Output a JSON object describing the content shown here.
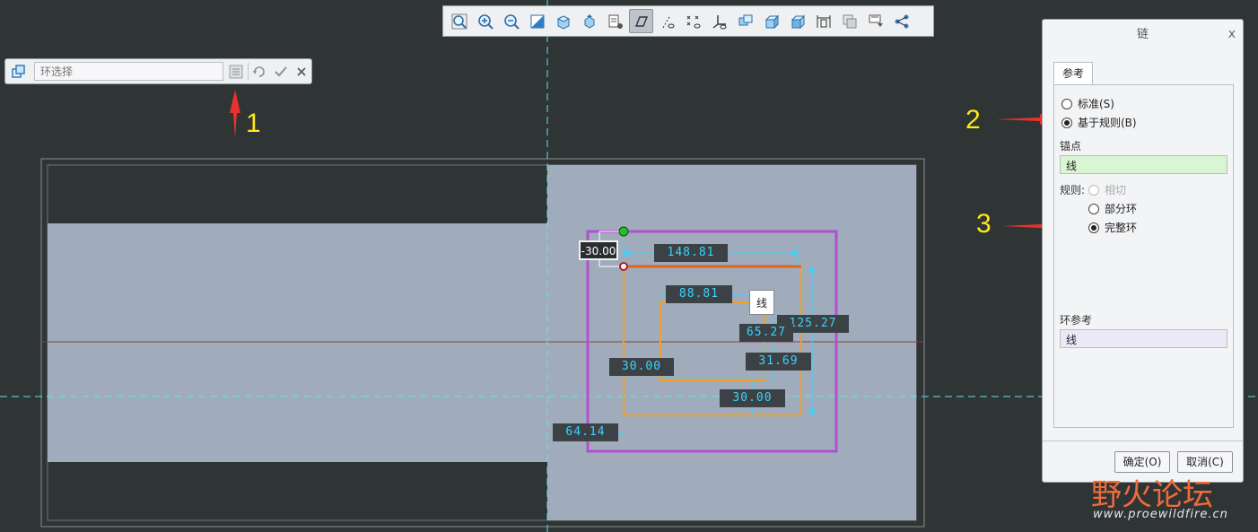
{
  "toolbar": {
    "tools": [
      {
        "icon": "zoom-fit-icon",
        "active": false
      },
      {
        "icon": "zoom-in-icon",
        "active": false
      },
      {
        "icon": "zoom-out-icon",
        "active": false
      },
      {
        "icon": "repaint-icon",
        "active": false
      },
      {
        "icon": "saved-orientation-icon",
        "active": false
      },
      {
        "icon": "view-manager-icon",
        "active": false
      },
      {
        "icon": "display-style-icon",
        "active": false
      },
      {
        "icon": "sketch-view-icon",
        "active": true
      },
      {
        "icon": "datum-axis-display-icon",
        "active": false
      },
      {
        "icon": "point-display-icon",
        "active": false
      },
      {
        "icon": "csys-display-icon",
        "active": false
      },
      {
        "icon": "annotation-display-icon",
        "active": false
      },
      {
        "icon": "shaded-icon",
        "active": false
      },
      {
        "icon": "wireframe-icon",
        "active": false
      },
      {
        "icon": "dimension-display-icon",
        "active": false
      },
      {
        "icon": "constraint-display-icon",
        "active": false
      },
      {
        "icon": "grid-display-icon",
        "active": false
      },
      {
        "icon": "vertex-display-icon",
        "active": false
      }
    ]
  },
  "loop_bar": {
    "input_placeholder": "环选择"
  },
  "annotations": [
    "1",
    "2",
    "3"
  ],
  "dialog": {
    "title": "链",
    "close": "x",
    "tab_label": "参考",
    "option_standard": "标准(S)",
    "option_rule": "基于规则(B)",
    "selected_mode": "rule",
    "anchor_label": "锚点",
    "anchor_value": "线",
    "rule_label": "规则:",
    "rule_tangent": "相切",
    "rule_partial": "部分环",
    "rule_complete": "完整环",
    "selected_rule": "complete",
    "loop_ref_label": "环参考",
    "loop_ref_value": "线",
    "ok_button": "确定(O)",
    "cancel_button": "取消(C)"
  },
  "sketch": {
    "offset_value": "-30.00",
    "tooltip": "线",
    "dimensions": [
      "148.81",
      "88.81",
      "125.27",
      "65.27",
      "30.00",
      "31.69",
      "30.00",
      "64.14"
    ]
  },
  "colors": {
    "canvas_bg": "#2f3435",
    "model_surface": "#a0acbb",
    "outer_loop": "#b44fd0",
    "inner_loop": "#f0a127",
    "dimension_text": "#3ad4ff",
    "annotation": "#ffe81a",
    "arrow": "#e8322b"
  },
  "watermark": {
    "title": "野火论坛",
    "url": "www.proewildfire.cn"
  }
}
